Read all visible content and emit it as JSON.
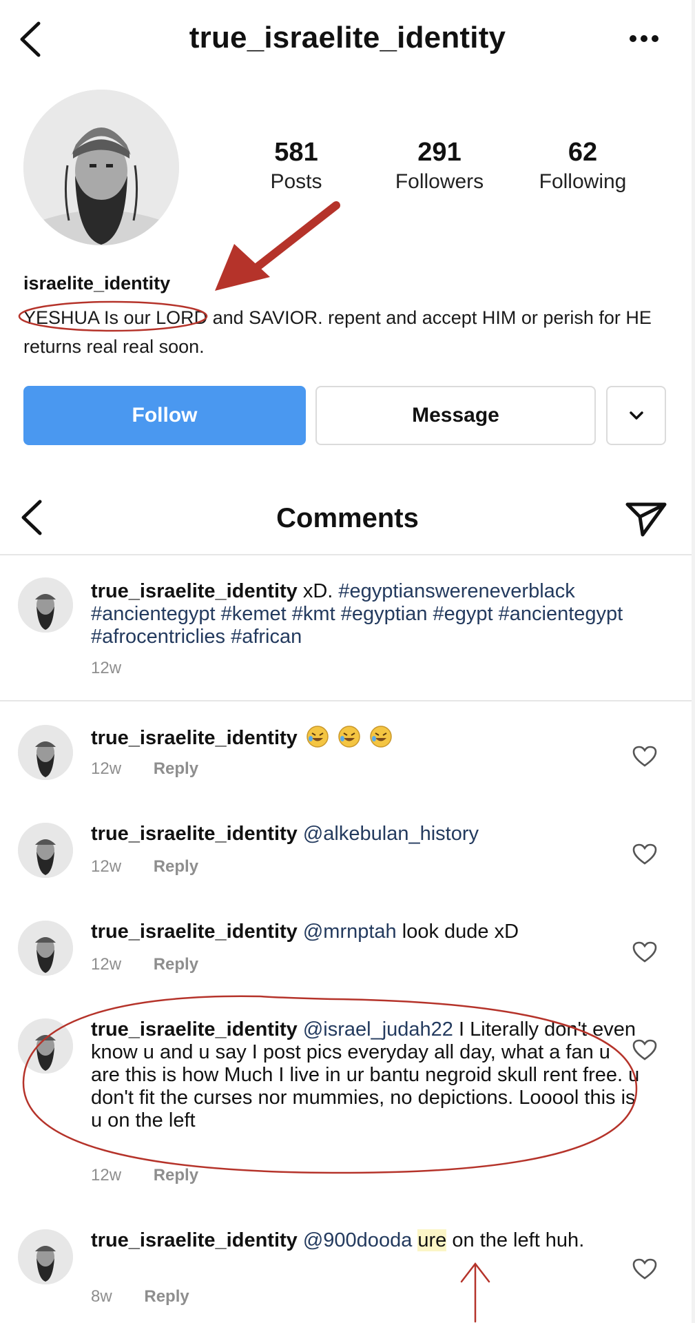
{
  "profile": {
    "username": "true_israelite_identity",
    "display_name": "israelite_identity",
    "bio": "YESHUA Is our LORD and SAVIOR. repent and accept HIM or perish for HE returns real real soon.",
    "stats": {
      "posts_count": "581",
      "posts_label": "Posts",
      "followers_count": "291",
      "followers_label": "Followers",
      "following_count": "62",
      "following_label": "Following"
    },
    "buttons": {
      "follow": "Follow",
      "message": "Message"
    }
  },
  "comments_header": {
    "title": "Comments"
  },
  "comments": [
    {
      "user": "true_israelite_identity",
      "text": "xD.",
      "hashtags": "#egyptianswereneverblack #ancientegypt #kemet #kmt #egyptian #egypt #ancientegypt #afrocentriclies #african",
      "time": "12w"
    },
    {
      "user": "true_israelite_identity",
      "time": "12w",
      "reply": "Reply",
      "emoji": "rolling-on-floor-laughing x3"
    },
    {
      "user": "true_israelite_identity",
      "mention": "@alkebulan_history",
      "time": "12w",
      "reply": "Reply"
    },
    {
      "user": "true_israelite_identity",
      "mention": "@mrnptah",
      "text": "look dude xD",
      "time": "12w",
      "reply": "Reply"
    },
    {
      "user": "true_israelite_identity",
      "mention": "@israel_judah22",
      "text": "I Literally don't even know u and u say I post pics everyday all day, what a fan u are this is how Much I live in ur bantu negroid skull rent free. u don't fit the curses nor mummies, no depictions. Looool  this is u on the left",
      "time": "12w",
      "reply": "Reply"
    },
    {
      "user": "true_israelite_identity",
      "mention": "@900dooda",
      "highlight": "ure",
      "text": "on the left huh.",
      "time": "8w",
      "reply": "Reply"
    }
  ],
  "colors": {
    "follow_blue": "#4a98f0",
    "link": "#233a5e",
    "annotation_red": "#b5332a",
    "muted": "#8e8e8e"
  },
  "icons": [
    "back-arrow-icon",
    "more-dots-icon",
    "chevron-down-icon",
    "send-icon",
    "heart-icon"
  ]
}
